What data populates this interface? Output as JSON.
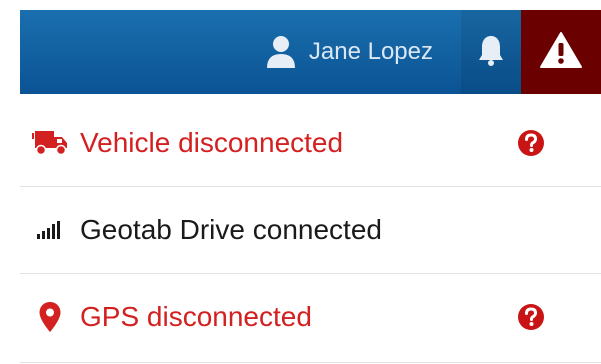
{
  "header": {
    "user_name": "Jane Lopez",
    "user_icon": "user-icon",
    "bell_icon": "bell-icon",
    "alert_icon": "warning-icon"
  },
  "status_items": [
    {
      "label": "Vehicle disconnected",
      "icon": "truck-icon",
      "status": "disconnected",
      "color": "#d32020",
      "help_icon": "question-circle-icon"
    },
    {
      "label": "Geotab Drive connected",
      "icon": "signal-bars-icon",
      "status": "connected",
      "color": "#1a1a1a"
    },
    {
      "label": "GPS disconnected",
      "icon": "map-marker-icon",
      "status": "disconnected",
      "color": "#d32020",
      "help_icon": "question-circle-icon"
    }
  ],
  "colors": {
    "header_blue": "#0b5394",
    "alert_red": "#6b0000",
    "error_red": "#d32020"
  }
}
